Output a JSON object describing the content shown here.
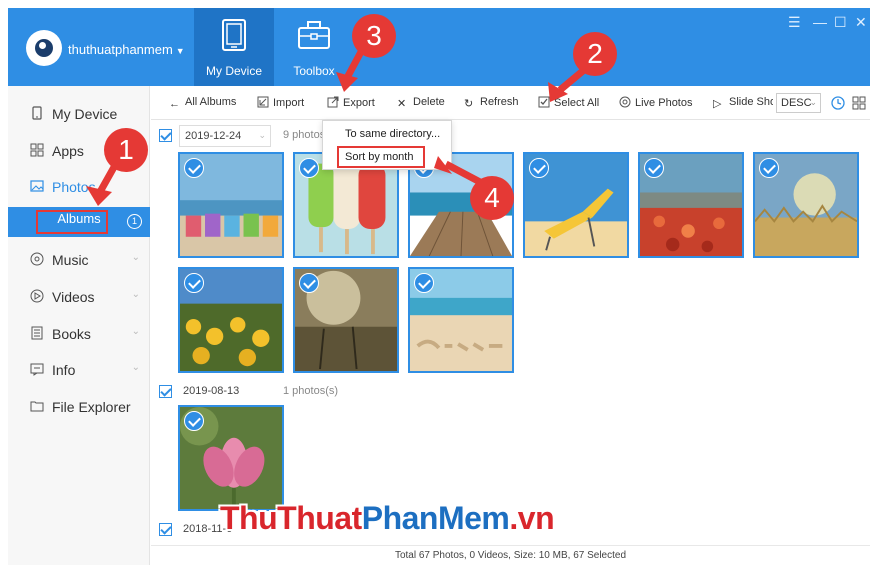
{
  "header": {
    "account_name": "thuthuatphanmem",
    "tabs": [
      {
        "label": "My Device",
        "icon": "tablet-icon",
        "active": true
      },
      {
        "label": "Toolbox",
        "icon": "toolbox-icon",
        "active": false
      }
    ],
    "window_controls": [
      "menu-icon",
      "minimize-icon",
      "maximize-icon",
      "close-icon"
    ]
  },
  "sidebar": {
    "items": [
      {
        "label": "My Device",
        "icon": "device-icon"
      },
      {
        "label": "Apps",
        "icon": "apps-grid-icon"
      },
      {
        "label": "Photos",
        "icon": "photo-icon",
        "active_section": true
      },
      {
        "label": "Albums",
        "icon": "",
        "selected": true,
        "count": "1"
      },
      {
        "label": "Music",
        "icon": "music-icon"
      },
      {
        "label": "Videos",
        "icon": "video-icon"
      },
      {
        "label": "Books",
        "icon": "book-icon"
      },
      {
        "label": "Info",
        "icon": "info-icon"
      },
      {
        "label": "File Explorer",
        "icon": "folder-icon"
      }
    ]
  },
  "toolbar": {
    "all_albums": "All Albums",
    "import": "Import",
    "export": "Export",
    "delete": "Delete",
    "refresh": "Refresh",
    "select_all": "Select All",
    "live_photos": "Live Photos",
    "slide_show": "Slide Sho",
    "sort": "DESC"
  },
  "export_menu": {
    "items": [
      "To same directory...",
      "Sort by month"
    ]
  },
  "groups": [
    {
      "date": "2019-12-24",
      "count": "9 photos",
      "photos": 9
    },
    {
      "date": "2019-08-13",
      "count": "1 photos(s)",
      "photos": 1
    },
    {
      "date": "2018-11-0",
      "count": "",
      "photos": 0
    }
  ],
  "status": "Total 67 Photos, 0 Videos, Size: 10 MB, 67 Selected",
  "annotations": {
    "badges": [
      "1",
      "2",
      "3",
      "4"
    ],
    "color": "#e53935"
  },
  "watermark": {
    "part1": "ThuThuat",
    "part2": "PhanMem",
    "part3": ".vn"
  },
  "colors": {
    "accent": "#2f8ee4",
    "accent_dark": "#1f74c6",
    "annotation": "#e53935"
  }
}
